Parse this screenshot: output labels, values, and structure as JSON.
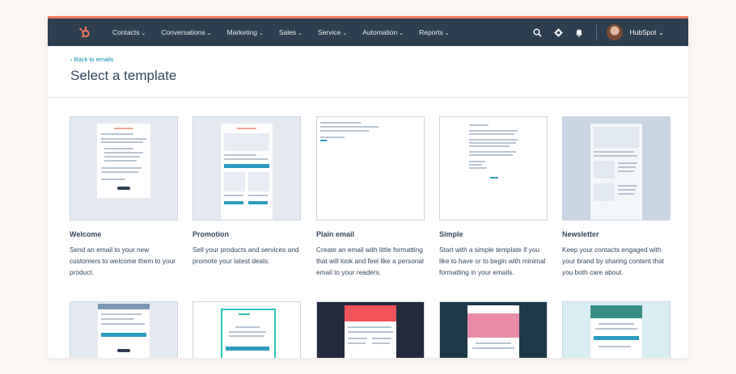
{
  "nav": {
    "items": [
      "Contacts",
      "Conversations",
      "Marketing",
      "Sales",
      "Service",
      "Automation",
      "Reports"
    ],
    "account": "HubSpot"
  },
  "header": {
    "back_link": "Back to emails",
    "title": "Select a template"
  },
  "templates": [
    {
      "name": "Welcome",
      "description": "Send an email to your new customers to welcome them to your product."
    },
    {
      "name": "Promotion",
      "description": "Sell your products and services and promote your latest deals."
    },
    {
      "name": "Plain email",
      "description": "Create an email with little formatting that will look and feel like a personal email to your readers."
    },
    {
      "name": "Simple",
      "description": "Start with a simple template if you like to have or to begin with minimal formatting in your emails."
    },
    {
      "name": "Newsletter",
      "description": "Keep your contacts engaged with your brand by sharing content that you both care about."
    }
  ],
  "colors": {
    "nav_bg": "#2d3e50",
    "accent": "#ff7a59",
    "link": "#0091ae",
    "text": "#33475b"
  },
  "icons": [
    "hubspot-sprocket-icon",
    "search-icon",
    "gear-icon",
    "bell-icon",
    "chevron-down-icon",
    "chevron-left-icon"
  ]
}
